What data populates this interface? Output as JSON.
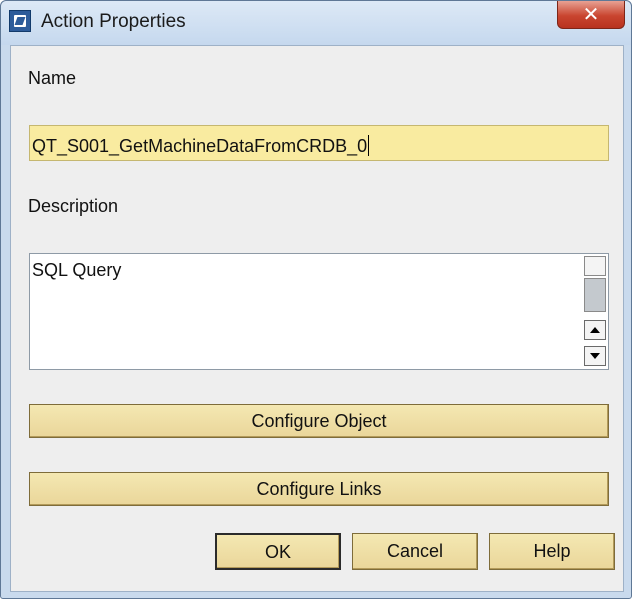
{
  "window": {
    "title": "Action Properties",
    "icon": "app-icon"
  },
  "name": {
    "label": "Name",
    "value": "QT_S001_GetMachineDataFromCRDB_0"
  },
  "description": {
    "label": "Description",
    "value": "SQL Query"
  },
  "buttons": {
    "configure_object": "Configure Object",
    "configure_links": "Configure Links",
    "ok": "OK",
    "cancel": "Cancel",
    "help": "Help"
  },
  "colors": {
    "field_highlight": "#f9eba0",
    "button_face": "#ead69a",
    "dialog_background": "#eeeeee",
    "close_button": "#c9452f"
  }
}
